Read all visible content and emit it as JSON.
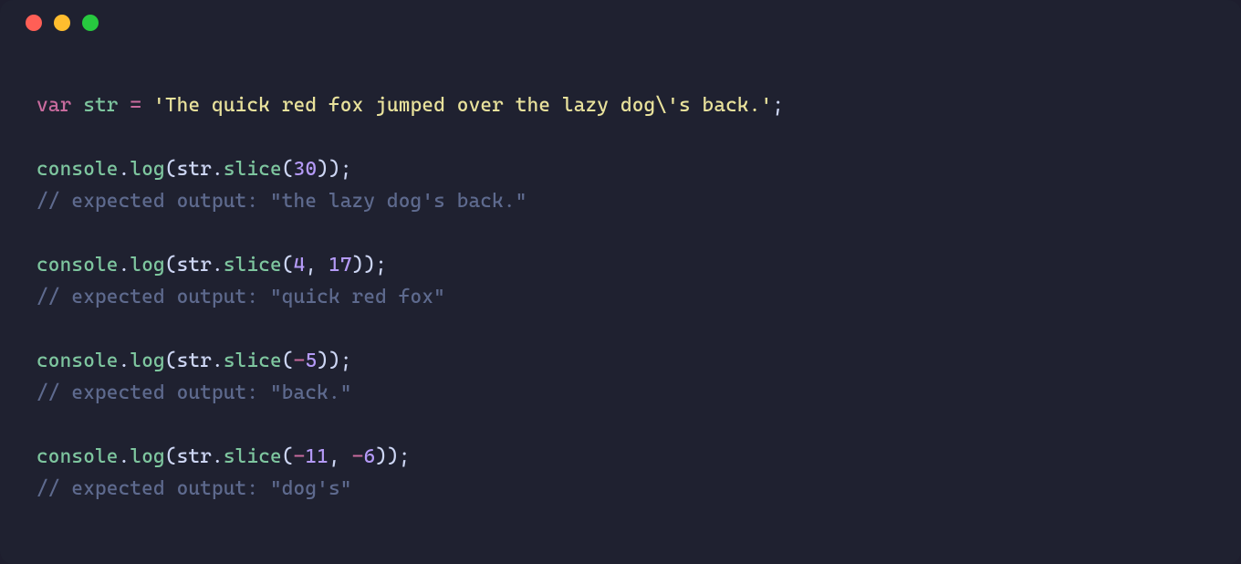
{
  "colors": {
    "bg": "#1f2130",
    "traffic_red": "#ff5f56",
    "traffic_yellow": "#ffbd2e",
    "traffic_green": "#27c93f",
    "keyword": "#c86b9e",
    "variable": "#7ec69f",
    "string": "#e9e29c",
    "number": "#b49af7",
    "comment": "#5e6a8e",
    "default": "#cdd6f4"
  },
  "code": {
    "lines": [
      [
        {
          "t": "var ",
          "c": "keyword"
        },
        {
          "t": "str",
          "c": "var"
        },
        {
          "t": " ",
          "c": "ident"
        },
        {
          "t": "=",
          "c": "op"
        },
        {
          "t": " ",
          "c": "ident"
        },
        {
          "t": "'The quick red fox jumped over the lazy dog\\'s back.'",
          "c": "str"
        },
        {
          "t": ";",
          "c": "punct"
        }
      ],
      [],
      [
        {
          "t": "console",
          "c": "var"
        },
        {
          "t": ".",
          "c": "punct"
        },
        {
          "t": "log",
          "c": "method"
        },
        {
          "t": "(",
          "c": "punct"
        },
        {
          "t": "str",
          "c": "ident"
        },
        {
          "t": ".",
          "c": "punct"
        },
        {
          "t": "slice",
          "c": "method"
        },
        {
          "t": "(",
          "c": "punct"
        },
        {
          "t": "30",
          "c": "num"
        },
        {
          "t": "));",
          "c": "punct"
        }
      ],
      [
        {
          "t": "// expected output: \"the lazy dog's back.\"",
          "c": "comment"
        }
      ],
      [],
      [
        {
          "t": "console",
          "c": "var"
        },
        {
          "t": ".",
          "c": "punct"
        },
        {
          "t": "log",
          "c": "method"
        },
        {
          "t": "(",
          "c": "punct"
        },
        {
          "t": "str",
          "c": "ident"
        },
        {
          "t": ".",
          "c": "punct"
        },
        {
          "t": "slice",
          "c": "method"
        },
        {
          "t": "(",
          "c": "punct"
        },
        {
          "t": "4",
          "c": "num"
        },
        {
          "t": ", ",
          "c": "punct"
        },
        {
          "t": "17",
          "c": "num"
        },
        {
          "t": "));",
          "c": "punct"
        }
      ],
      [
        {
          "t": "// expected output: \"quick red fox\"",
          "c": "comment"
        }
      ],
      [],
      [
        {
          "t": "console",
          "c": "var"
        },
        {
          "t": ".",
          "c": "punct"
        },
        {
          "t": "log",
          "c": "method"
        },
        {
          "t": "(",
          "c": "punct"
        },
        {
          "t": "str",
          "c": "ident"
        },
        {
          "t": ".",
          "c": "punct"
        },
        {
          "t": "slice",
          "c": "method"
        },
        {
          "t": "(",
          "c": "punct"
        },
        {
          "t": "-",
          "c": "op"
        },
        {
          "t": "5",
          "c": "num"
        },
        {
          "t": "));",
          "c": "punct"
        }
      ],
      [
        {
          "t": "// expected output: \"back.\"",
          "c": "comment"
        }
      ],
      [],
      [
        {
          "t": "console",
          "c": "var"
        },
        {
          "t": ".",
          "c": "punct"
        },
        {
          "t": "log",
          "c": "method"
        },
        {
          "t": "(",
          "c": "punct"
        },
        {
          "t": "str",
          "c": "ident"
        },
        {
          "t": ".",
          "c": "punct"
        },
        {
          "t": "slice",
          "c": "method"
        },
        {
          "t": "(",
          "c": "punct"
        },
        {
          "t": "-",
          "c": "op"
        },
        {
          "t": "11",
          "c": "num"
        },
        {
          "t": ", ",
          "c": "punct"
        },
        {
          "t": "-",
          "c": "op"
        },
        {
          "t": "6",
          "c": "num"
        },
        {
          "t": "));",
          "c": "punct"
        }
      ],
      [
        {
          "t": "// expected output: \"dog's\"",
          "c": "comment"
        }
      ]
    ]
  }
}
